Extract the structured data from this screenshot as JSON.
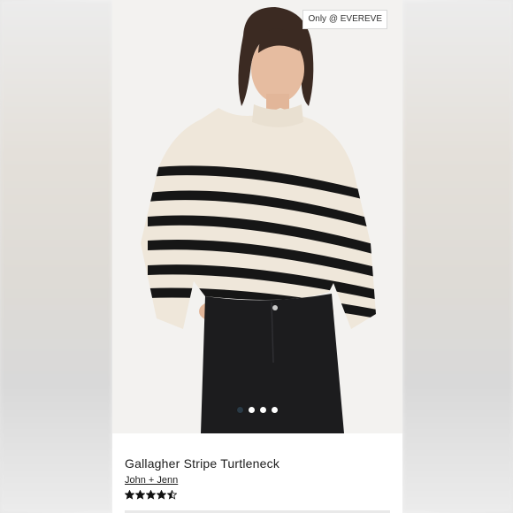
{
  "badge": {
    "label": "Only @ EVEREVE"
  },
  "product": {
    "title": "Gallagher Stripe Turtleneck",
    "brand": "John + Jenn",
    "rating": 4.5,
    "rating_max": 5,
    "stars_icon": "star-icon"
  },
  "carousel": {
    "slides": 4,
    "active_index": 0
  },
  "colors": {
    "sweater_cream": "#efe7da",
    "stripe_black": "#161616",
    "jeans_black": "#1c1c1e",
    "active_dot": "#2a3a46"
  }
}
